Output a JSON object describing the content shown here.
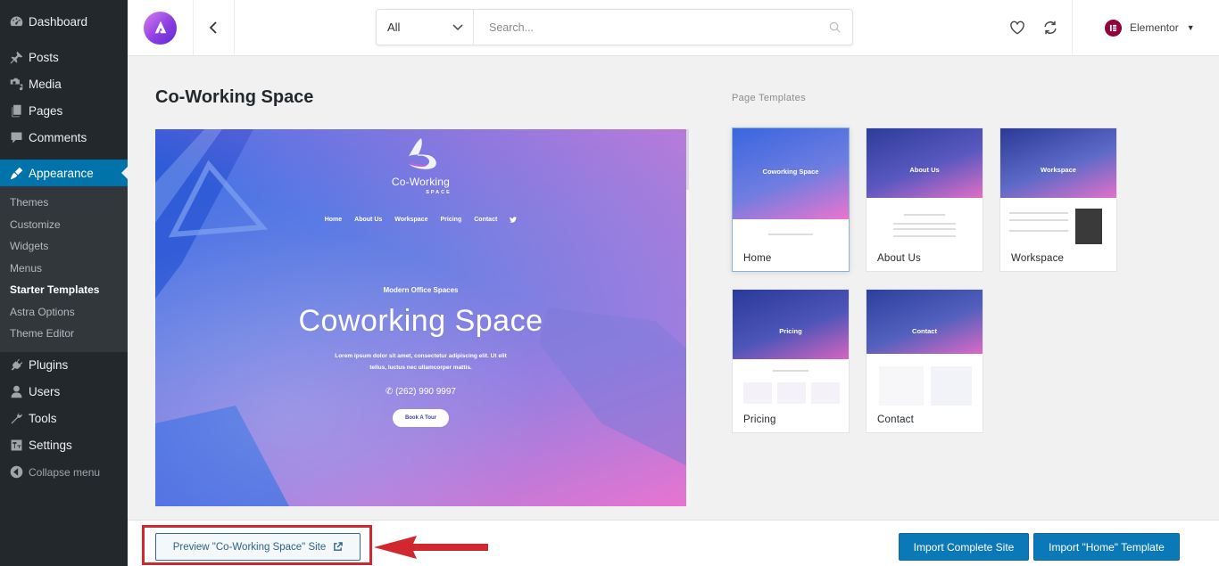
{
  "sidebar": {
    "items": [
      {
        "label": "Dashboard",
        "icon": "dashboard-icon"
      },
      {
        "label": "Posts",
        "icon": "pin-icon"
      },
      {
        "label": "Media",
        "icon": "media-icon"
      },
      {
        "label": "Pages",
        "icon": "pages-icon"
      },
      {
        "label": "Comments",
        "icon": "comment-icon"
      },
      {
        "label": "Appearance",
        "icon": "paintbrush-icon",
        "active": true
      },
      {
        "label": "Plugins",
        "icon": "plugin-icon"
      },
      {
        "label": "Users",
        "icon": "user-icon"
      },
      {
        "label": "Tools",
        "icon": "wrench-icon"
      },
      {
        "label": "Settings",
        "icon": "settings-icon"
      }
    ],
    "submenu": [
      "Themes",
      "Customize",
      "Widgets",
      "Menus",
      "Starter Templates",
      "Astra Options",
      "Theme Editor"
    ],
    "submenu_current": "Starter Templates",
    "collapse_label": "Collapse menu"
  },
  "header": {
    "filter_selected": "All",
    "search_placeholder": "Search...",
    "page_builder": "Elementor"
  },
  "main": {
    "title": "Co-Working Space",
    "preview": {
      "brand": "Co-Working",
      "brand_sub": "SPACE",
      "nav": [
        "Home",
        "About Us",
        "Workspace",
        "Pricing",
        "Contact"
      ],
      "tagline": "Modern Office Spaces",
      "headline": "Coworking Space",
      "paragraph_line1": "Lorem ipsum dolor sit amet, consectetur adipiscing elit. Ut elit",
      "paragraph_line2": "tellus, luctus nec ullamcorper mattis.",
      "phone": "(262) 990 9997",
      "cta": "Book A Tour",
      "colors": {
        "gradient_start": "#3b6fe6",
        "gradient_end": "#e874d0"
      }
    }
  },
  "page_templates": {
    "heading": "Page Templates",
    "selected": "Home",
    "cards": [
      {
        "label": "Home",
        "hero_title": "Coworking Space",
        "selected": true
      },
      {
        "label": "About Us",
        "hero_title": "About Us"
      },
      {
        "label": "Workspace",
        "hero_title": "Workspace"
      },
      {
        "label": "Pricing",
        "hero_title": "Pricing"
      },
      {
        "label": "Contact",
        "hero_title": "Contact"
      }
    ]
  },
  "footer": {
    "preview_label": "Preview \"Co-Working Space\" Site",
    "import_site_label": "Import Complete Site",
    "import_template_label": "Import \"Home\" Template",
    "accent_color": "#0b78b8",
    "annotation_color": "#d0282e"
  }
}
